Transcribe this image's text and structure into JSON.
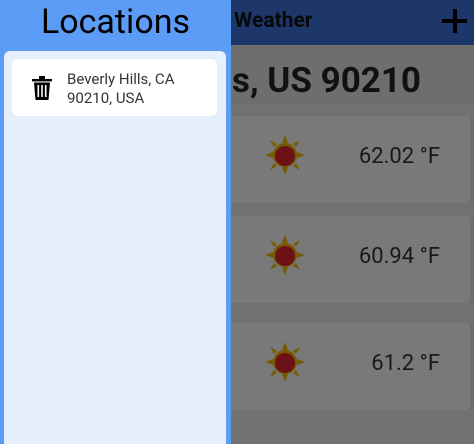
{
  "drawer": {
    "title": "Locations",
    "items": [
      {
        "line1": "Beverly Hills, CA",
        "line2": "90210, USA",
        "delete_icon": "trash-icon"
      }
    ]
  },
  "appbar": {
    "title": "Weather",
    "add_icon": "plus-icon"
  },
  "main": {
    "location_heading": "s, US 90210",
    "forecast": [
      {
        "icon": "sun-icon",
        "temp": "62.02 °F"
      },
      {
        "icon": "sun-icon",
        "temp": "60.94 °F"
      },
      {
        "icon": "sun-icon",
        "temp": "61.2 °F"
      }
    ]
  },
  "colors": {
    "drawer_header": "#5b9cf6",
    "drawer_body": "#e6effc",
    "appbar": "#3c6fd6",
    "sun": "#e9b800",
    "sun_core": "#d8222a"
  }
}
